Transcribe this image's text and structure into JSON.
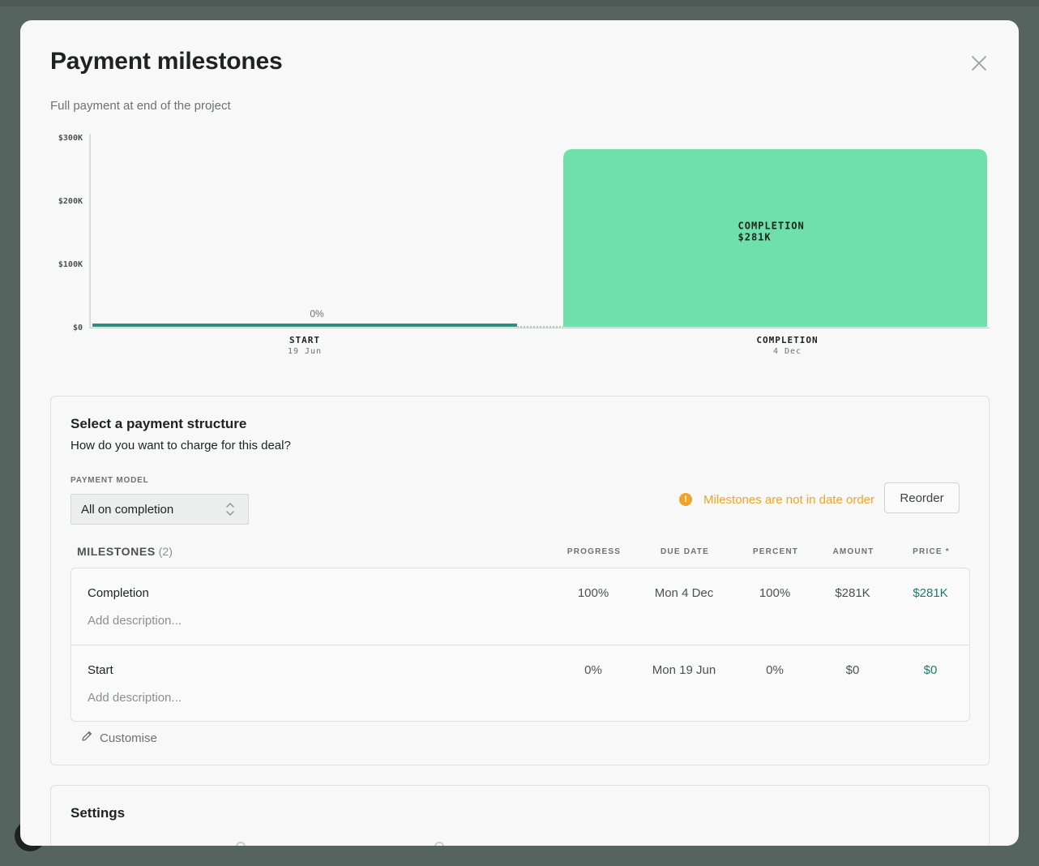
{
  "modal": {
    "title": "Payment milestones",
    "subtitle": "Full payment at end of the project",
    "close_icon": "close-icon"
  },
  "chart_data": {
    "type": "bar",
    "categories": [
      "START",
      "COMPLETION"
    ],
    "category_dates": [
      "19 Jun",
      "4 Dec"
    ],
    "values": [
      0,
      281
    ],
    "value_unit": "$K",
    "bar_labels": [
      "0%",
      "COMPLETION\n$281K"
    ],
    "yticks": [
      "$0",
      "$100K",
      "$200K",
      "$300K"
    ],
    "ylim": [
      0,
      300
    ],
    "colors": {
      "start": "#2f8f7e",
      "completion": "#6fe0a9"
    }
  },
  "structure": {
    "title": "Select a payment structure",
    "description": "How do you want to charge for this deal?",
    "payment_model_label": "PAYMENT MODEL",
    "payment_model_value": "All on completion",
    "warning": "Milestones are not in date order",
    "warning_icon": "!",
    "reorder_label": "Reorder",
    "milestones_label": "MILESTONES",
    "milestones_count": "(2)",
    "columns": [
      "PROGRESS",
      "DUE DATE",
      "PERCENT",
      "AMOUNT",
      "PRICE *"
    ],
    "rows": [
      {
        "name": "Completion",
        "description_placeholder": "Add description...",
        "progress": "100%",
        "due_date": "Mon 4 Dec",
        "percent": "100%",
        "amount": "$281K",
        "price": "$281K"
      },
      {
        "name": "Start",
        "description_placeholder": "Add description...",
        "progress": "0%",
        "due_date": "Mon 19 Jun",
        "percent": "0%",
        "amount": "$0",
        "price": "$0"
      }
    ],
    "customise_label": "Customise"
  },
  "settings": {
    "title": "Settings"
  }
}
